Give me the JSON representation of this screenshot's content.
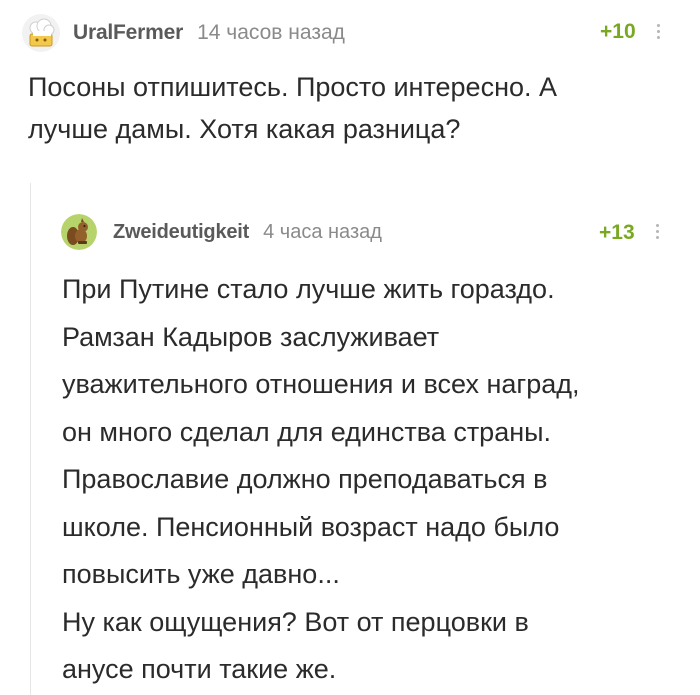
{
  "comments": [
    {
      "username": "UralFermer",
      "timestamp": "14 часов назад",
      "rating": "+10",
      "avatar_icon": "chef-hat-avatar-icon",
      "lines": [
        "Посоны отпишитесь. Просто интересно. А",
        "лучше дамы. Хотя какая разница?"
      ]
    },
    {
      "username": "Zweideutigkeit",
      "timestamp": "4 часа назад",
      "rating": "+13",
      "avatar_icon": "squirrel-avatar-icon",
      "lines": [
        "При Путине стало лучше жить гораздо.",
        "Рамзан Кадыров заслуживает",
        "уважительного отношения и всех наград,",
        "он много сделал для единства страны.",
        "Православие должно преподаваться в",
        "школе. Пенсионный возраст надо было",
        "повысить уже давно...",
        "Ну как ощущения? Вот от перцовки в",
        "анусе почти такие же."
      ]
    }
  ],
  "colors": {
    "rating_positive": "#79a823",
    "text": "#2b2b2b",
    "meta": "#8a8a8a"
  }
}
